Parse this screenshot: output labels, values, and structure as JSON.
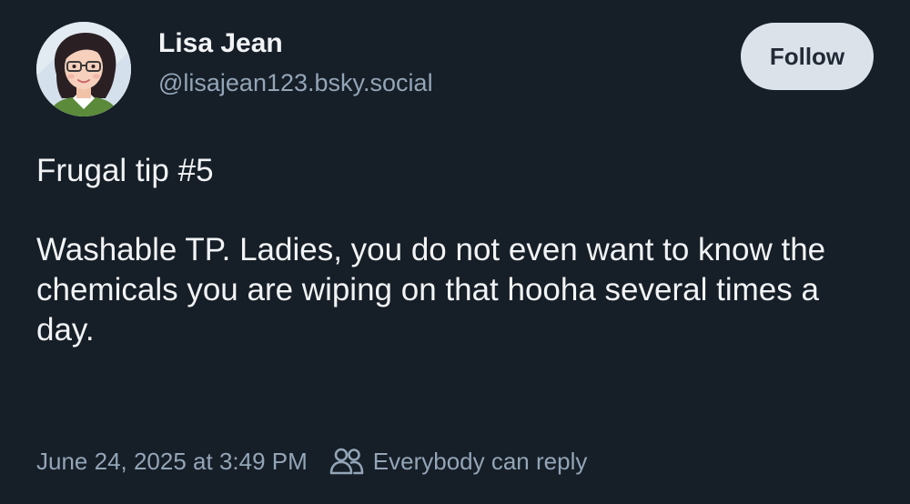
{
  "author": {
    "name": "Lisa Jean",
    "handle": "@lisajean123.bsky.social",
    "avatar_icon": "cartoon-woman-avatar"
  },
  "follow_button": {
    "label": "Follow"
  },
  "post": {
    "paragraphs": [
      "Frugal tip #5",
      "Washable TP. Ladies, you do not even want to know the chemicals you are wiping on that hooha several times a day."
    ]
  },
  "meta": {
    "timestamp": "June 24, 2025 at 3:49 PM",
    "reply_icon": "people-icon",
    "reply_setting": "Everybody can reply"
  },
  "colors": {
    "background": "#161e27",
    "text": "#f1f3f5",
    "secondary_text": "#93a5b7",
    "button_bg": "#dce2ea",
    "button_text": "#212a35"
  }
}
